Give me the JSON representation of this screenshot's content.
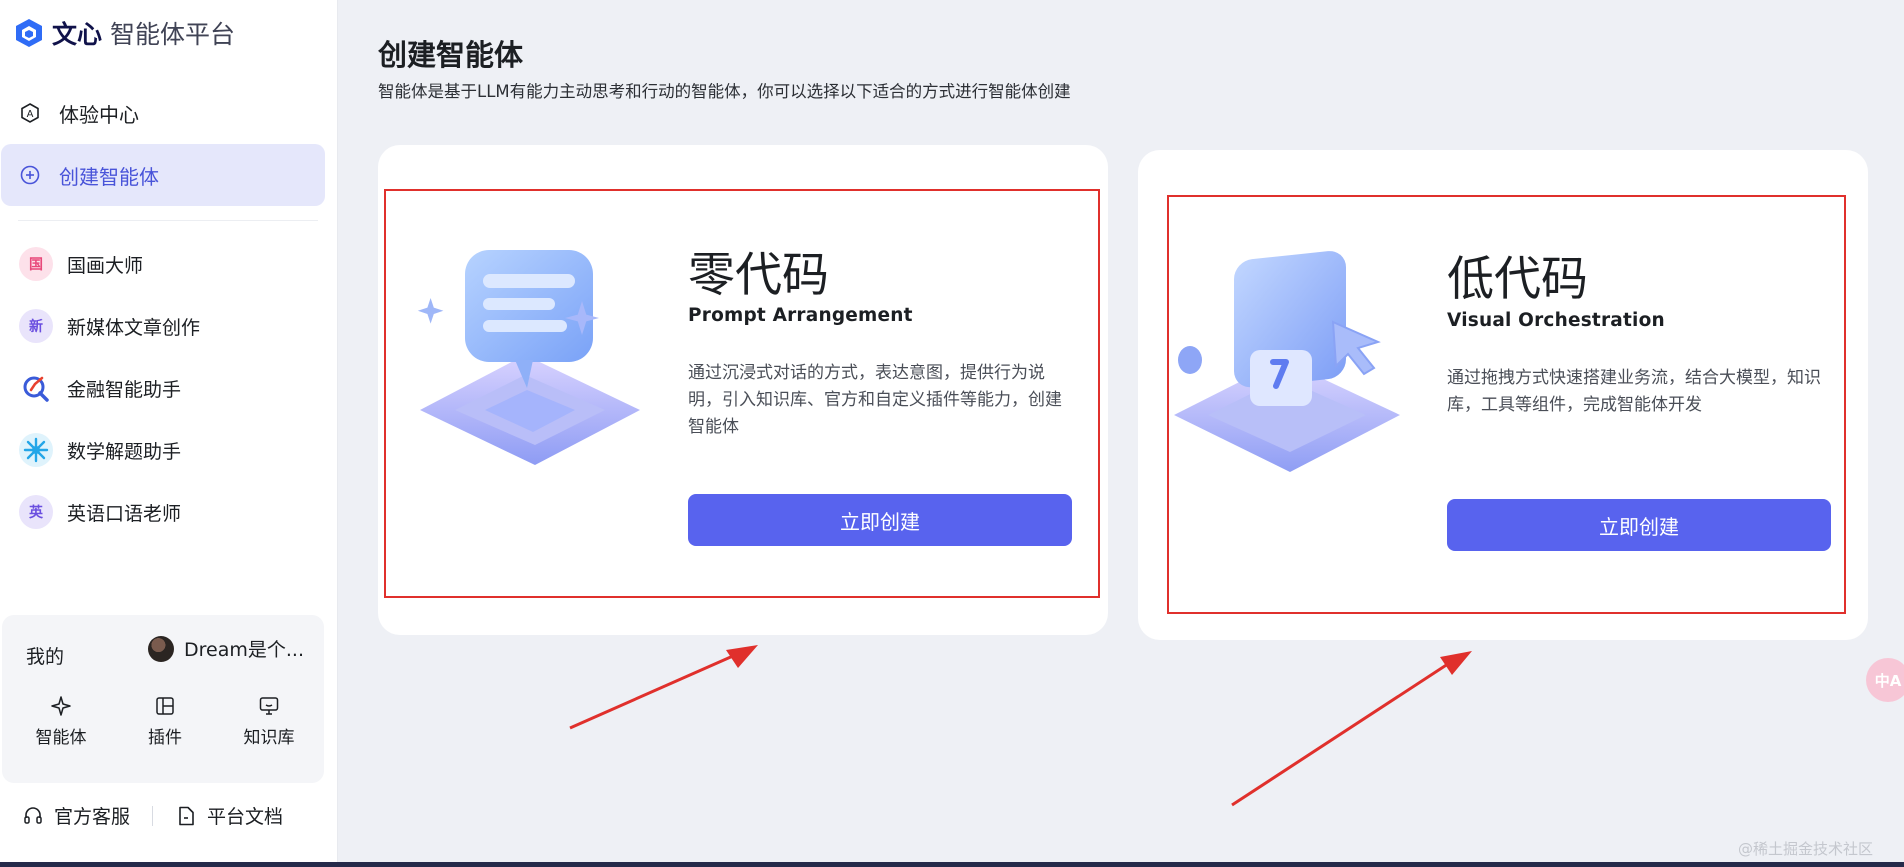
{
  "brand": {
    "strong": "文心",
    "light": "智能体平台"
  },
  "nav": [
    {
      "label": "体验中心",
      "icon": "experience-icon",
      "active": false
    },
    {
      "label": "创建智能体",
      "icon": "plus-circle-icon",
      "active": true
    }
  ],
  "agents": [
    {
      "name": "国画大师",
      "badge": "国",
      "color": "#e8487a"
    },
    {
      "name": "新媒体文章创作",
      "badge": "新",
      "color": "#6b4fe0"
    },
    {
      "name": "金融智能助手",
      "badge": "",
      "color": "#3a5bd9"
    },
    {
      "name": "数学解题助手",
      "badge": "",
      "color": "#23a6e8"
    },
    {
      "name": "英语口语老师",
      "badge": "英",
      "color": "#6b4fe0"
    }
  ],
  "mine": {
    "label": "我的",
    "user": "Dream是个...",
    "tools": [
      {
        "label": "智能体",
        "icon": "sparkle-icon"
      },
      {
        "label": "插件",
        "icon": "plugin-icon"
      },
      {
        "label": "知识库",
        "icon": "knowledge-monitor-icon"
      }
    ]
  },
  "footer": {
    "support": "官方客服",
    "docs": "平台文档"
  },
  "main": {
    "title": "创建智能体",
    "description": "智能体是基于LLM有能力主动思考和行动的智能体，你可以选择以下适合的方式进行智能体创建"
  },
  "cards": [
    {
      "heading": "零代码",
      "subtitle": "Prompt Arrangement",
      "description": "通过沉浸式对话的方式，表达意图，提供行为说明，引入知识库、官方和自定义插件等能力，创建智能体",
      "button": "立即创建"
    },
    {
      "heading": "低代码",
      "subtitle": "Visual Orchestration",
      "description": "通过拖拽方式快速搭建业务流，结合大模型，知识库，工具等组件，完成智能体开发",
      "button": "立即创建"
    }
  ],
  "floating": {
    "translate": "中A"
  },
  "watermark": "@稀土掘金技术社区",
  "colors": {
    "accent": "#5863ee",
    "active_bg": "#e5e7fb",
    "highlight": "#e0302c"
  }
}
